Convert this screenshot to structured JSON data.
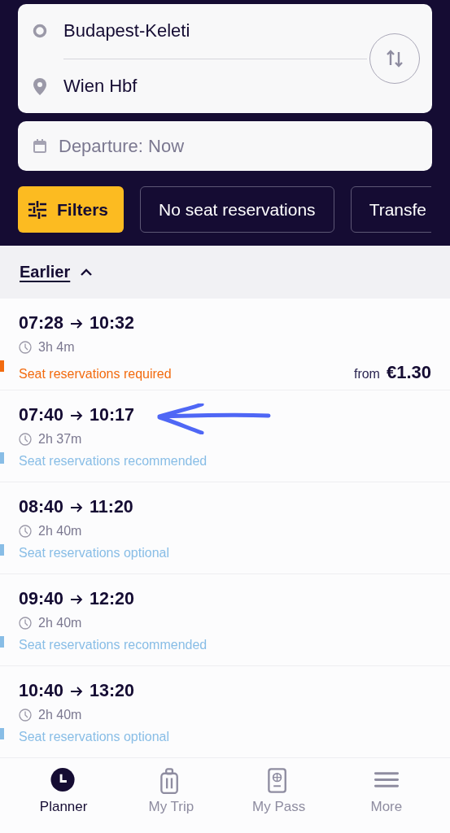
{
  "route": {
    "origin": "Budapest-Keleti",
    "destination": "Wien Hbf"
  },
  "departure": {
    "value": "Departure: Now"
  },
  "filters": [
    {
      "label": "Filters",
      "kind": "primary"
    },
    {
      "label": "No seat reservations",
      "kind": "chip"
    },
    {
      "label": "Transfe",
      "kind": "chip"
    }
  ],
  "earlier": {
    "label": "Earlier",
    "expanded": true
  },
  "trips": [
    {
      "departure": "07:28",
      "arrival": "10:32",
      "duration": "3h 4m",
      "reservation": "Seat reservations required",
      "color": "#f26b0f",
      "price_prefix": "from",
      "price": "€1.30"
    },
    {
      "departure": "07:40",
      "arrival": "10:17",
      "duration": "2h 37m",
      "reservation": "Seat reservations recommended",
      "color": "#88bde6",
      "annotated": true
    },
    {
      "departure": "08:40",
      "arrival": "11:20",
      "duration": "2h 40m",
      "reservation": "Seat reservations optional",
      "color": "#88bde6"
    },
    {
      "departure": "09:40",
      "arrival": "12:20",
      "duration": "2h 40m",
      "reservation": "Seat reservations recommended",
      "color": "#88bde6"
    },
    {
      "departure": "10:40",
      "arrival": "13:20",
      "duration": "2h 40m",
      "reservation": "Seat reservations optional",
      "color": "#88bde6"
    }
  ],
  "nav": [
    {
      "label": "Planner",
      "kind": "planner",
      "selected": true
    },
    {
      "label": "My Trip",
      "kind": "trip",
      "selected": false
    },
    {
      "label": "My Pass",
      "kind": "pass",
      "selected": false
    },
    {
      "label": "More",
      "kind": "more",
      "selected": false
    }
  ]
}
